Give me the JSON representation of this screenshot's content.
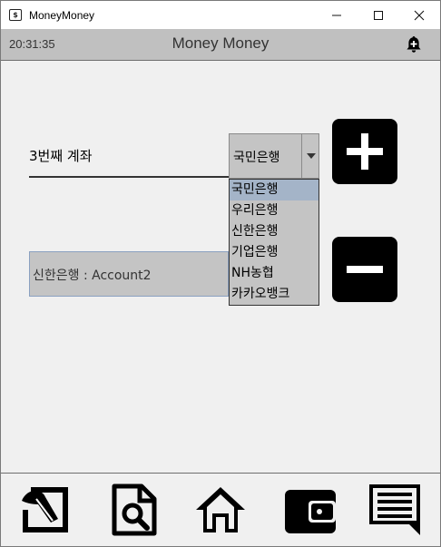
{
  "window": {
    "title": "MoneyMoney",
    "app_icon_glyph": "$",
    "controls": [
      "minimize-icon",
      "maximize-icon",
      "close-icon"
    ]
  },
  "header": {
    "time": "20:31:35",
    "title": "Money Money",
    "notification_icon": "bell-plus-icon"
  },
  "form": {
    "account_name": "3번째 계좌",
    "bank_select": {
      "selected": "국민은행",
      "options": [
        "국민은행",
        "우리은행",
        "신한은행",
        "기업은행",
        "NH농협",
        "카카오뱅크"
      ]
    },
    "account_display": "신한은행 : Account2",
    "add_icon": "plus-icon",
    "remove_icon": "minus-icon"
  },
  "bottom_nav": {
    "items": [
      "edit-icon",
      "search-document-icon",
      "home-icon",
      "wallet-icon",
      "chat-list-icon"
    ]
  }
}
